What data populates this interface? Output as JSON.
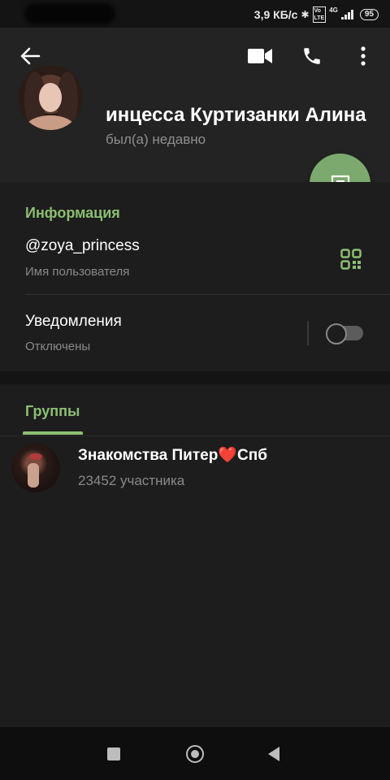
{
  "status_bar": {
    "net_speed": "3,9 КБ/с",
    "network_type": "4G",
    "volte_label": "Vo LTE",
    "battery": "95"
  },
  "toolbar": {
    "back_icon": "arrow-left-icon",
    "video_icon": "video-camera-icon",
    "call_icon": "phone-icon",
    "more_icon": "more-vertical-icon"
  },
  "profile": {
    "name": "инцесса Куртизанки Алина",
    "status": "был(а) недавно",
    "message_button_icon": "chat-bubble-icon"
  },
  "info": {
    "section_title": "Информация",
    "username": "@zoya_princess",
    "username_label": "Имя пользователя",
    "qr_icon": "qr-code-icon",
    "notifications_title": "Уведомления",
    "notifications_state": "Отключены",
    "notifications_enabled": false
  },
  "tabs": {
    "groups_label": "Группы"
  },
  "groups": [
    {
      "name_prefix": "Знакомства Питер",
      "name_emoji": "❤️",
      "name_suffix": "Спб",
      "members": "23452 участника"
    }
  ],
  "colors": {
    "accent": "#8cbf72",
    "fab": "#7ba96e",
    "background": "#1d1d1d"
  }
}
